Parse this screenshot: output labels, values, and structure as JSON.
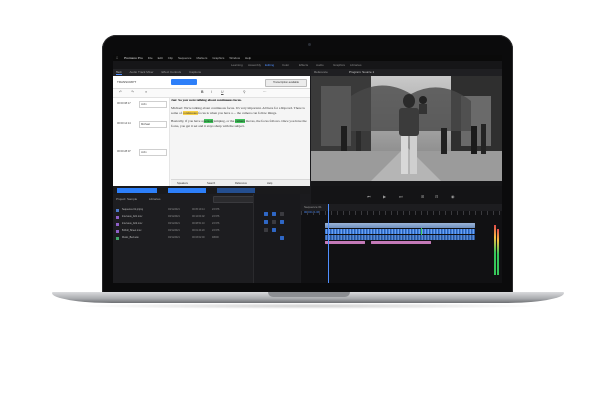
{
  "app": {
    "name": "Premiere Pro",
    "menu": [
      "Premiere Pro",
      "File",
      "Edit",
      "Clip",
      "Sequence",
      "Markers",
      "Graphics",
      "Window",
      "Help"
    ]
  },
  "workspaces": [
    "Learning",
    "Assembly",
    "Editing",
    "Color",
    "Effects",
    "Audio",
    "Graphics",
    "Libraries"
  ],
  "workspace_active": "Editing",
  "transcript": {
    "panel_tabs": [
      "Text",
      "Audio Track Mixer",
      "Effect Controls",
      "Captions"
    ],
    "active_tab": "Text",
    "header_label": "TRANSCRIPT",
    "action_button": "",
    "secondary_button": "Transcription available",
    "toolbar_icons": [
      "undo-icon",
      "redo-icon",
      "align-icon",
      "bold-icon",
      "italic-icon",
      "underline-icon",
      "search-icon",
      "more-icon"
    ],
    "speakers": [
      {
        "time": "00:00:08:17",
        "name": "John"
      },
      {
        "time": "00:00:14:14",
        "name": "Michael"
      },
      {
        "time": "00:00:28:07",
        "name": "John"
      }
    ],
    "paragraphs": [
      {
        "pre": "Jon:  So you were talking about ",
        "hl": "",
        "post": "continuous focus."
      },
      {
        "pre": "Michael: We're talking about continuous focus. It's very important. All here for a Ripcord. There is some of ",
        "hl": "continuous",
        "post": " focus is when you have a ... the camera can follow things."
      },
      {
        "pre": "Basically, if you have a ",
        "hl": "person",
        "post": " jumping, or the ",
        "hl2": "camera",
        "post2": " moves, the focus follows. Once you have the focus, you get it set and it stays sharp with the subject."
      }
    ],
    "bottom": [
      "Speakers",
      "Search",
      "Reference",
      "Help"
    ]
  },
  "monitor": {
    "tabs": [
      "Reference",
      "Program: Source 1"
    ],
    "timecode_left": "00:00:21:08",
    "timecode_right": "00:05:19:14"
  },
  "project": {
    "tabs": [
      "Project: Sample",
      "Libraries"
    ],
    "items": [
      {
        "name": "Sequence 01.prproj",
        "date": "03/11/2021",
        "extra": "00:05:19:14",
        "fps": "23.976"
      },
      {
        "name": "Interview_A01.mov",
        "date": "03/11/2021",
        "extra": "00:12:04:02",
        "fps": "23.976"
      },
      {
        "name": "Interview_A02.mov",
        "date": "03/11/2021",
        "extra": "00:08:51:10",
        "fps": "23.976"
      },
      {
        "name": "B-Roll_Street.mov",
        "date": "03/11/2021",
        "extra": "00:01:44:20",
        "fps": "23.976"
      },
      {
        "name": "Music_Bed.wav",
        "date": "03/11/2021",
        "extra": "00:03:02:00",
        "fps": "48000"
      }
    ]
  },
  "timeline": {
    "tab": "Sequence 01",
    "timecode": "00:00:21:08"
  },
  "colors": {
    "accent": "#2d7ff9",
    "highlight_yellow": "#f7d046",
    "highlight_green": "#3fc25a"
  }
}
